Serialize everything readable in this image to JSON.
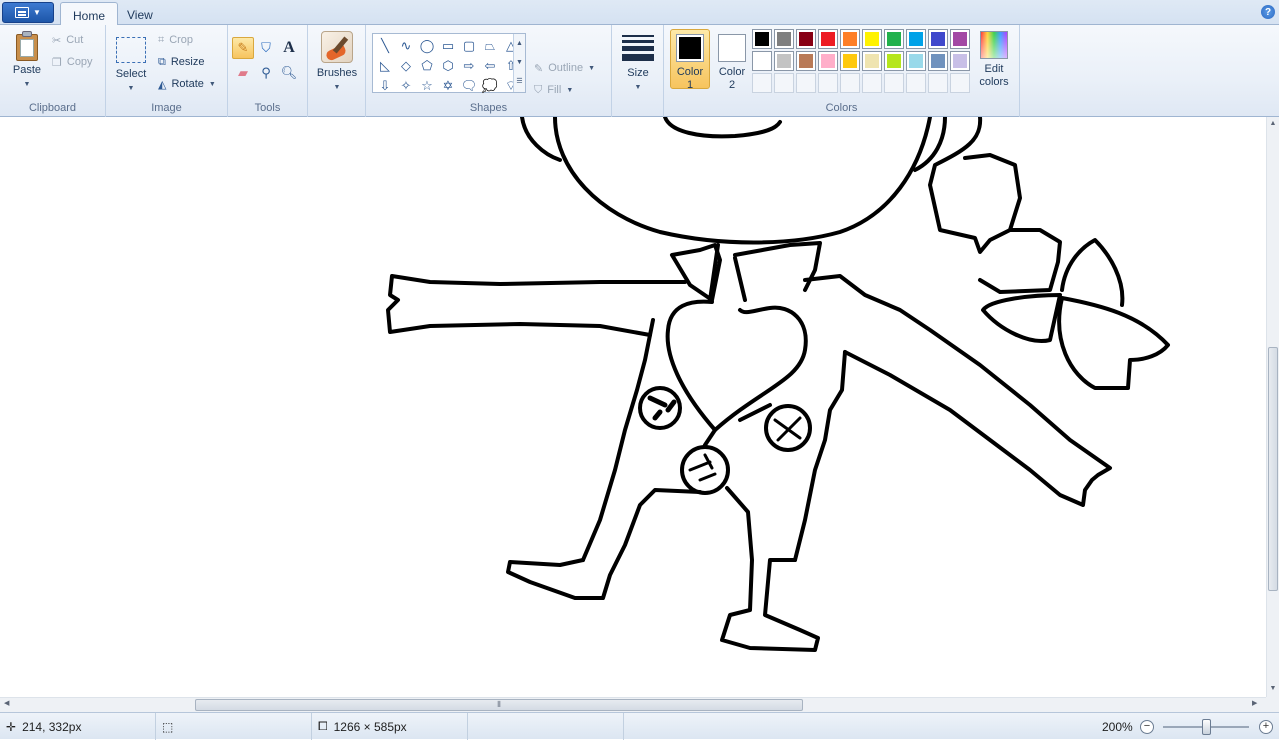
{
  "tabs": [
    {
      "label": "Home",
      "active": true
    },
    {
      "label": "View",
      "active": false
    }
  ],
  "clipboard": {
    "paste": "Paste",
    "cut": "Cut",
    "copy": "Copy",
    "group_label": "Clipboard"
  },
  "image": {
    "select": "Select",
    "crop": "Crop",
    "resize": "Resize",
    "rotate": "Rotate",
    "group_label": "Image"
  },
  "tools": {
    "group_label": "Tools",
    "items": [
      "pencil-icon",
      "fill-bucket-icon",
      "text-icon",
      "eraser-icon",
      "color-picker-icon",
      "magnifier-icon"
    ],
    "active": "pencil-icon"
  },
  "brushes": {
    "label": "Brushes"
  },
  "shapes": {
    "group_label": "Shapes",
    "outline": "Outline",
    "fill": "Fill",
    "glyphs": [
      "╲",
      "∿",
      "◯",
      "▭",
      "▢",
      "⏢",
      "△",
      "◺",
      "◇",
      "⬠",
      "⬡",
      "⇨",
      "⇦",
      "⇧",
      "⇩",
      "✧",
      "☆",
      "✡",
      "🗨",
      "💭",
      "⌔"
    ]
  },
  "size": {
    "label": "Size"
  },
  "colors": {
    "group_label": "Colors",
    "color1": {
      "line1": "Color",
      "line2": "1",
      "value": "#000000"
    },
    "color2": {
      "line1": "Color",
      "line2": "2",
      "value": "#ffffff"
    },
    "palette": [
      "#000000",
      "#7f7f7f",
      "#880015",
      "#ed1c24",
      "#ff7f27",
      "#fff200",
      "#22b14c",
      "#00a2e8",
      "#3f48cc",
      "#a349a4",
      "#ffffff",
      "#c3c3c3",
      "#b97a57",
      "#ffaec9",
      "#ffc90e",
      "#efe4b0",
      "#b5e61d",
      "#99d9ea",
      "#7092be",
      "#c8bfe7"
    ],
    "empty_slots": 10,
    "edit_line1": "Edit",
    "edit_line2": "colors"
  },
  "status": {
    "cursor_pos": "214, 332px",
    "selection_size": "",
    "canvas_size": "1266 × 585px",
    "zoom": "200%"
  },
  "zoom_level": 0.5,
  "accent": "#1d56a8"
}
